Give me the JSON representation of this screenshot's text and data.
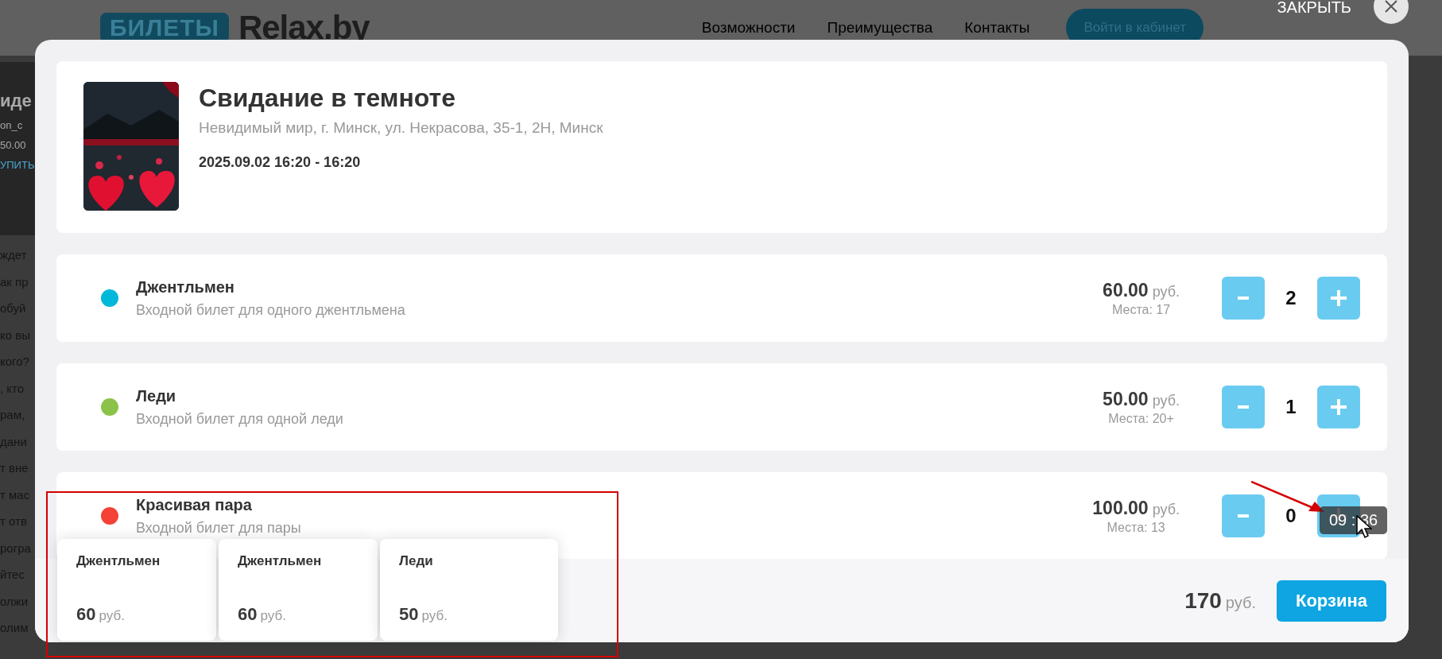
{
  "header": {
    "logo_badge": "БИЛЕТЫ",
    "logo_text": "Relax.by",
    "nav": [
      "Возможности",
      "Преимущества",
      "Контакты"
    ],
    "login_button": "Войти в кабинет"
  },
  "close": {
    "label": "ЗАКРЫТЬ"
  },
  "background_page": {
    "banner": [
      "иде",
      "on_c",
      "50.00",
      "УПИТЬ"
    ],
    "lines": [
      "ждет",
      "ак пр",
      "обуй",
      "ко вы",
      "кого?",
      ", кто",
      "рам,",
      "дани",
      "т вне",
      "т мас",
      "т отв",
      "рогра",
      "йтес",
      "олжи",
      "олим"
    ]
  },
  "event": {
    "title": "Свидание в темноте",
    "venue": "Невидимый мир, г. Минск, ул. Некрасова, 35-1, 2Н, Минск",
    "datetime": "2025.09.02 16:20 - 16:20"
  },
  "tickets": [
    {
      "name": "Джентльмен",
      "description": "Входной билет для одного джентльмена",
      "price": "60.00",
      "currency": "руб.",
      "seats": "Места: 17",
      "count": "2",
      "color": "#00b8d9"
    },
    {
      "name": "Леди",
      "description": "Входной билет для одной леди",
      "price": "50.00",
      "currency": "руб.",
      "seats": "Места: 20+",
      "count": "1",
      "color": "#8bc34a"
    },
    {
      "name": "Красивая пара",
      "description": "Входной билет для пары",
      "price": "100.00",
      "currency": "руб.",
      "seats": "Места: 13",
      "count": "0",
      "color": "#f44336"
    }
  ],
  "footer": {
    "total": "170",
    "currency": "руб.",
    "cart_button": "Корзина"
  },
  "cart_items": [
    {
      "name": "Джентльмен",
      "price": "60",
      "currency": "руб."
    },
    {
      "name": "Джентльмен",
      "price": "60",
      "currency": "руб."
    },
    {
      "name": "Леди",
      "price": "50",
      "currency": "руб."
    }
  ],
  "timer_tooltip": {
    "text": "09 : 36"
  }
}
